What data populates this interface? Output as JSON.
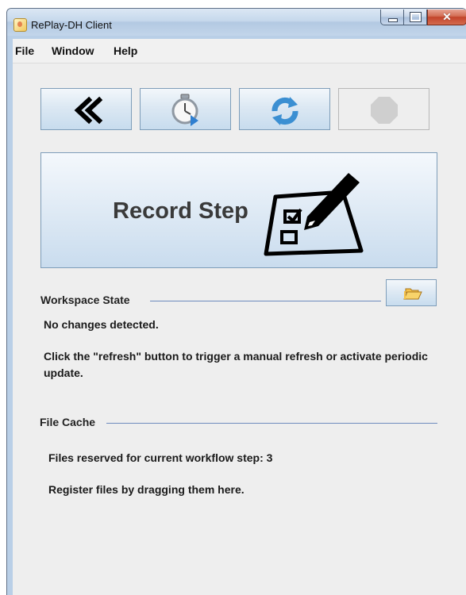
{
  "window": {
    "title": "RePlay-DH Client"
  },
  "menubar": {
    "items": [
      "File",
      "Window",
      "Help"
    ]
  },
  "toolbar": {
    "buttons": [
      {
        "icon": "double-chevron-left-icon",
        "enabled": true
      },
      {
        "icon": "stopwatch-icon",
        "enabled": true
      },
      {
        "icon": "refresh-icon",
        "enabled": true
      },
      {
        "icon": "stop-octagon-icon",
        "enabled": false
      }
    ]
  },
  "record": {
    "label": "Record Step",
    "icon": "checklist-pencil-icon"
  },
  "workspace": {
    "heading": "Workspace State",
    "status": "No changes detected.",
    "hint": "Click the \"refresh\" button to trigger a manual refresh or activate periodic update.",
    "folder_icon": "open-folder-icon"
  },
  "file_cache": {
    "heading": "File Cache",
    "reserved": "Files reserved for current workflow step: 3",
    "register": "Register files by dragging them here."
  },
  "colors": {
    "button_blue_light": "#f3f7fb",
    "button_blue_dark": "#c7dcee",
    "separator": "#6d8bbd",
    "refresh_icon": "#3b8fd2",
    "close_red": "#c2442a"
  }
}
